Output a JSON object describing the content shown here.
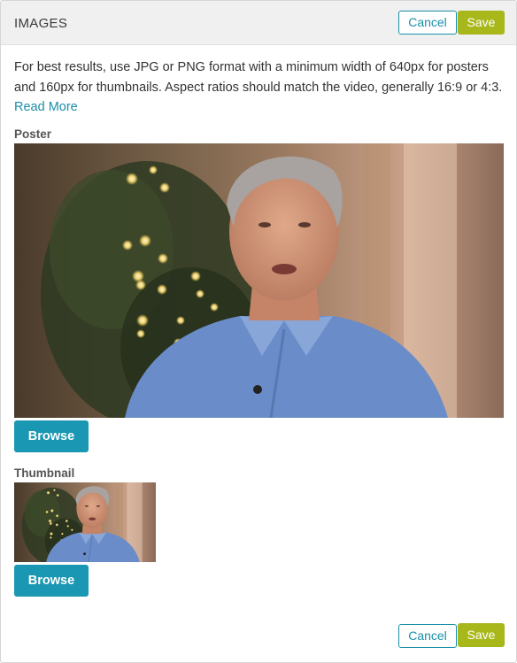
{
  "header": {
    "title": "IMAGES",
    "cancel_label": "Cancel",
    "save_label": "Save"
  },
  "info": {
    "text": "For best results, use JPG or PNG format with a minimum width of 640px for posters and 160px for thumbnails. Aspect ratios should match the video, generally 16:9 or 4:3.",
    "read_more_label": "Read More"
  },
  "poster": {
    "label": "Poster",
    "browse_label": "Browse"
  },
  "thumbnail": {
    "label": "Thumbnail",
    "browse_label": "Browse"
  },
  "footer": {
    "cancel_label": "Cancel",
    "save_label": "Save"
  },
  "colors": {
    "accent_teal": "#1a97b2",
    "save_green": "#a8b81a",
    "header_bg": "#f0f0f0"
  }
}
